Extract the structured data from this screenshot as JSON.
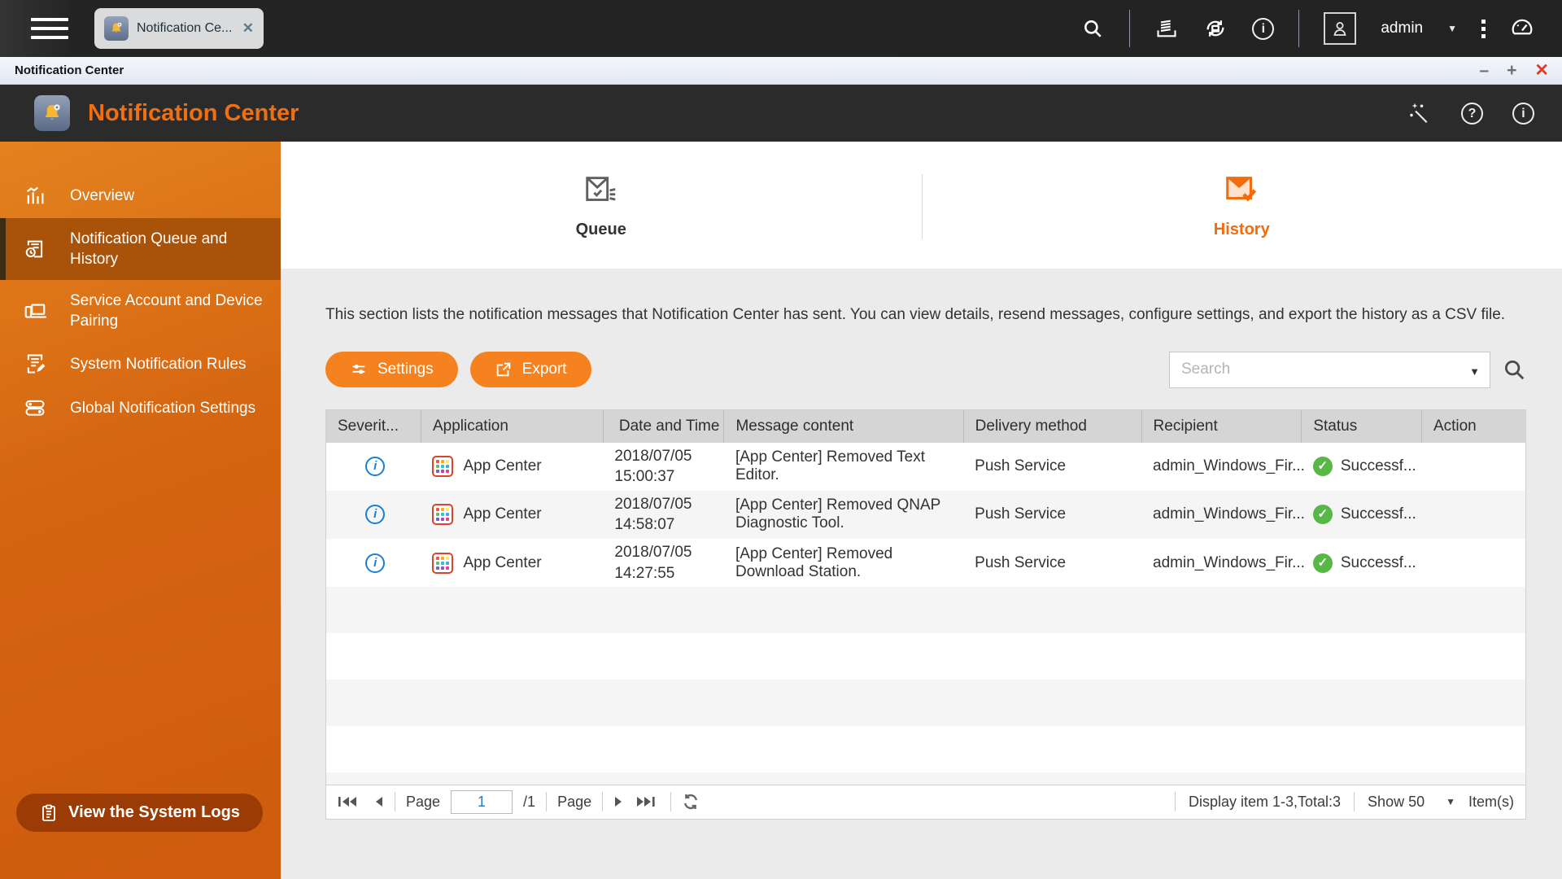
{
  "topbar": {
    "tab": {
      "label": "Notification Ce...",
      "app_icon": "notification-bell-app-icon",
      "close_icon": "close-icon"
    },
    "icons": [
      "search-icon",
      "background-tasks-icon",
      "external-device-sync-icon",
      "info-icon",
      "user-avatar-icon",
      "more-menu-icon",
      "dashboard-gauge-icon"
    ],
    "user": "admin"
  },
  "window": {
    "title": "Notification Center",
    "controls": [
      "minimize-icon",
      "maximize-icon",
      "close-icon"
    ]
  },
  "app_header": {
    "title": "Notification Center",
    "icons": [
      "magic-wand-icon",
      "help-icon",
      "about-icon"
    ]
  },
  "sidebar": {
    "items": [
      {
        "label": "Overview",
        "icon": "bar-chart-icon",
        "selected": false
      },
      {
        "label": "Notification Queue and History",
        "icon": "document-history-icon",
        "selected": true
      },
      {
        "label": "Service Account and Device Pairing",
        "icon": "devices-icon",
        "selected": false
      },
      {
        "label": "System Notification Rules",
        "icon": "document-edit-icon",
        "selected": false
      },
      {
        "label": "Global Notification Settings",
        "icon": "toggles-icon",
        "selected": false
      }
    ],
    "footer_button": "View the System Logs"
  },
  "tabs": [
    {
      "label": "Queue",
      "icon": "queue-envelope-icon",
      "active": false
    },
    {
      "label": "History",
      "icon": "history-envelope-icon",
      "active": true
    }
  ],
  "description": "This section lists the notification messages that Notification Center has sent. You can view details, resend messages, configure settings, and export the history as a CSV file.",
  "toolbar": {
    "settings_label": "Settings",
    "export_label": "Export",
    "search_placeholder": "Search"
  },
  "table": {
    "headers": [
      "Severit...",
      "Application",
      "Date and Time",
      "Message content",
      "Delivery method",
      "Recipient",
      "Status",
      "Action"
    ],
    "rows": [
      {
        "severity": "information",
        "application": "App Center",
        "date": "2018/07/05",
        "time": "15:00:37",
        "message": "[App Center] Removed Text Editor.",
        "delivery": "Push Service",
        "recipient": "admin_Windows_Fir...",
        "status": "Successf..."
      },
      {
        "severity": "information",
        "application": "App Center",
        "date": "2018/07/05",
        "time": "14:58:07",
        "message": "[App Center] Removed QNAP Diagnostic Tool.",
        "delivery": "Push Service",
        "recipient": "admin_Windows_Fir...",
        "status": "Successf..."
      },
      {
        "severity": "information",
        "application": "App Center",
        "date": "2018/07/05",
        "time": "14:27:55",
        "message": "[App Center] Removed Download Station.",
        "delivery": "Push Service",
        "recipient": "admin_Windows_Fir...",
        "status": "Successf..."
      }
    ]
  },
  "pagination": {
    "page_label": "Page",
    "page_value": "1",
    "total_pages": "/1",
    "page_label_2": "Page",
    "display_text": "Display item 1-3,Total:3",
    "show_label": "Show 50",
    "items_label": "Item(s)"
  },
  "colors": {
    "accent": "#f26c0d",
    "sidebar": "#d56410",
    "success": "#57b847",
    "info_severity": "#1a7fd4"
  }
}
